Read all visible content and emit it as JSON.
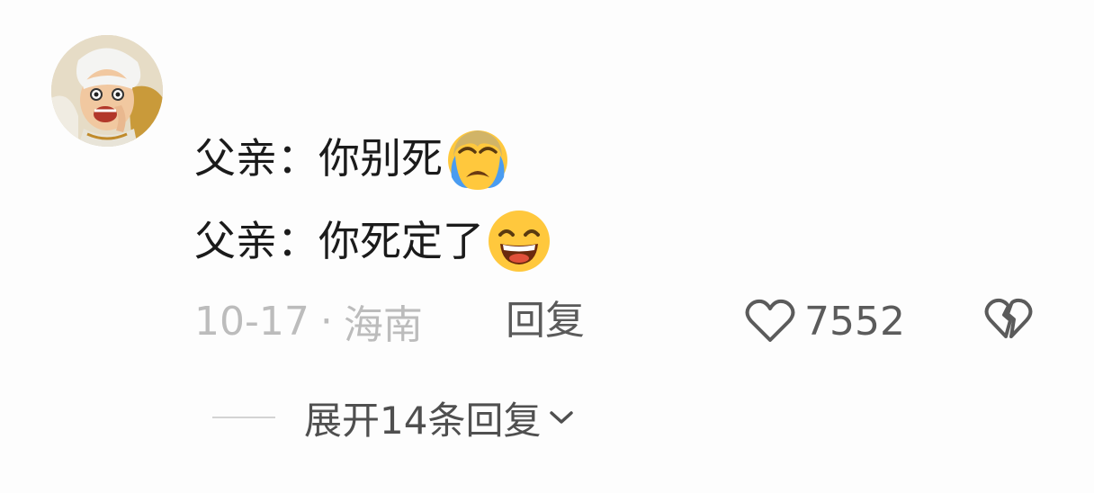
{
  "comment": {
    "lines": [
      {
        "text": "父亲：你别死",
        "emoji": "loudly-crying-face-emoji"
      },
      {
        "text": "父亲：你死定了",
        "emoji": "grinning-squinting-face-emoji"
      }
    ],
    "date": "10-17",
    "separator": "·",
    "location": "海南",
    "reply_label": "回复",
    "like_count": "7552",
    "expand_label": "展开14条回复"
  },
  "icons": {
    "like": "heart-outline-icon",
    "dislike": "broken-heart-icon",
    "expand": "chevron-down-icon"
  },
  "colors": {
    "background": "#fdfdfd",
    "text_primary": "#1b1b1b",
    "text_meta": "#bcbcbc",
    "text_action": "#5a5a5a",
    "emoji_yellow": "#ffc83d",
    "tear_blue": "#4a9cf0"
  }
}
